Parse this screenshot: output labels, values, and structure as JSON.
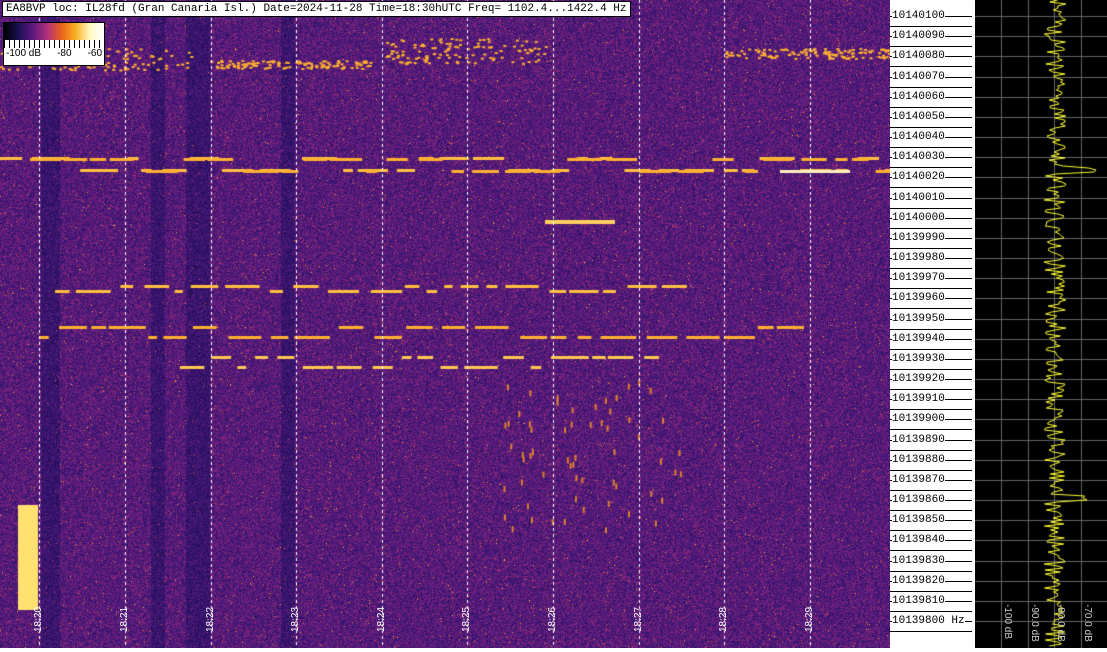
{
  "header": {
    "title": "EA8BVP loc: IL28fd (Gran Canaria Isl.) Date=2024-11-28 Time=18:30hUTC Freq= 1102.4...1422.4 Hz"
  },
  "legend": {
    "labels": [
      "-100 dB",
      "-80",
      "-60"
    ]
  },
  "chart_data": {
    "type": "heatmap",
    "title": "EA8BVP loc: IL28fd (Gran Canaria Isl.) Date=2024-11-28 Time=18:30hUTC Freq= 1102.4...1422.4 Hz",
    "x_ticks": [
      "18:20",
      "18:21",
      "18:22",
      "18:23",
      "18:24",
      "18:25",
      "18:26",
      "18:27",
      "18:28",
      "18:29"
    ],
    "y_ticks": [
      "10140100",
      "10140090",
      "10140080",
      "10140070",
      "10140060",
      "10140050",
      "10140040",
      "10140030",
      "10140020",
      "10140010",
      "10140000",
      "10139990",
      "10139980",
      "10139970",
      "10139960",
      "10139950",
      "10139940",
      "10139930",
      "10139920",
      "10139910",
      "10139900",
      "10139890",
      "10139880",
      "10139870",
      "10139860",
      "10139850",
      "10139840",
      "10139830",
      "10139820",
      "10139810",
      "10139800 Hz"
    ],
    "ylim": [
      10139795,
      10140105
    ],
    "color_range_db": [
      -100,
      -60
    ],
    "spectrum_ticks": [
      "-100 dB",
      "-90.0 dB",
      "-80.0 dB",
      "-70.0 dB"
    ]
  },
  "colors": {
    "bg": "#2a0f5a",
    "trace": "#ffd060",
    "spectrum": "#ffff30"
  }
}
